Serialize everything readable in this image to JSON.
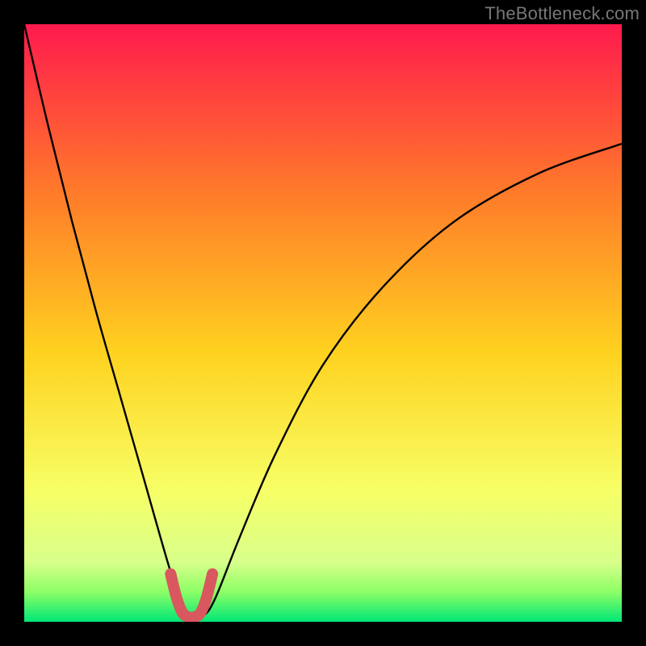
{
  "watermark": "TheBottleneck.com",
  "colors": {
    "bg": "#000000",
    "grad_top": "#ff1a4d",
    "grad_mid1": "#ff7a2a",
    "grad_mid2": "#ffd21f",
    "grad_low": "#f7ff66",
    "grad_green1": "#8dff66",
    "grad_green2": "#00e676",
    "curve": "#000000",
    "highlight": "#d9575e"
  },
  "chart_data": {
    "type": "line",
    "title": "",
    "xlabel": "",
    "ylabel": "",
    "xlim": [
      0,
      100
    ],
    "ylim": [
      0,
      100
    ],
    "series": [
      {
        "name": "bottleneck-curve",
        "x": [
          0,
          4,
          8,
          12,
          16,
          20,
          24,
          26,
          28,
          30,
          32,
          36,
          42,
          50,
          60,
          72,
          86,
          100
        ],
        "values": [
          100,
          83,
          67,
          52,
          38,
          24,
          10,
          4,
          1,
          1,
          4,
          14,
          28,
          43,
          56,
          67,
          75,
          80
        ]
      },
      {
        "name": "highlight-valley",
        "x": [
          24.5,
          25.5,
          26.5,
          27.5,
          28.5,
          29.5,
          30.5,
          31.5
        ],
        "values": [
          8,
          4,
          1.5,
          0.8,
          0.8,
          1.5,
          4,
          8
        ]
      }
    ],
    "gradient_stops": [
      {
        "pct": 0,
        "color": "#ff1a4d"
      },
      {
        "pct": 28,
        "color": "#ff7a2a"
      },
      {
        "pct": 55,
        "color": "#ffd21f"
      },
      {
        "pct": 78,
        "color": "#f7ff66"
      },
      {
        "pct": 90,
        "color": "#d8ff8a"
      },
      {
        "pct": 95,
        "color": "#8dff66"
      },
      {
        "pct": 100,
        "color": "#00e676"
      }
    ]
  }
}
